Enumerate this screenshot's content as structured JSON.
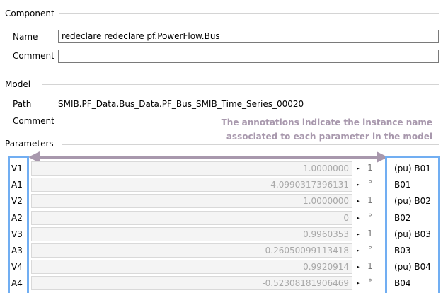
{
  "component": {
    "title": "Component",
    "name_label": "Name",
    "name_value": "redeclare redeclare pf.PowerFlow.Bus",
    "comment_label": "Comment",
    "comment_value": ""
  },
  "model": {
    "title": "Model",
    "path_label": "Path",
    "path_value": "SMIB.PF_Data.Bus_Data.PF_Bus_SMIB_Time_Series_00020",
    "comment_label": "Comment"
  },
  "annotation": {
    "line1": "The annotations indicate the instance name",
    "line2": "associated to each parameter in the model",
    "color": "#a898ad",
    "highlight_color": "#71aef2"
  },
  "parameters": {
    "title": "Parameters",
    "rows": [
      {
        "name": "V1",
        "value": "1.0000000",
        "arrow": "▸",
        "unit": "1",
        "comment": "(pu) B01"
      },
      {
        "name": "A1",
        "value": "4.0990317396131",
        "arrow": "▸",
        "unit": "°",
        "comment": "B01"
      },
      {
        "name": "V2",
        "value": "1.0000000",
        "arrow": "▸",
        "unit": "1",
        "comment": "(pu) B02"
      },
      {
        "name": "A2",
        "value": "0",
        "arrow": "▸",
        "unit": "°",
        "comment": "B02"
      },
      {
        "name": "V3",
        "value": "0.9960353",
        "arrow": "▸",
        "unit": "1",
        "comment": "(pu) B03"
      },
      {
        "name": "A3",
        "value": "-0.26050099113418",
        "arrow": "▸",
        "unit": "°",
        "comment": "B03"
      },
      {
        "name": "V4",
        "value": "0.9920914",
        "arrow": "▸",
        "unit": "1",
        "comment": "(pu) B04"
      },
      {
        "name": "A4",
        "value": "-0.52308181906469",
        "arrow": "▸",
        "unit": "°",
        "comment": "B04"
      }
    ]
  }
}
